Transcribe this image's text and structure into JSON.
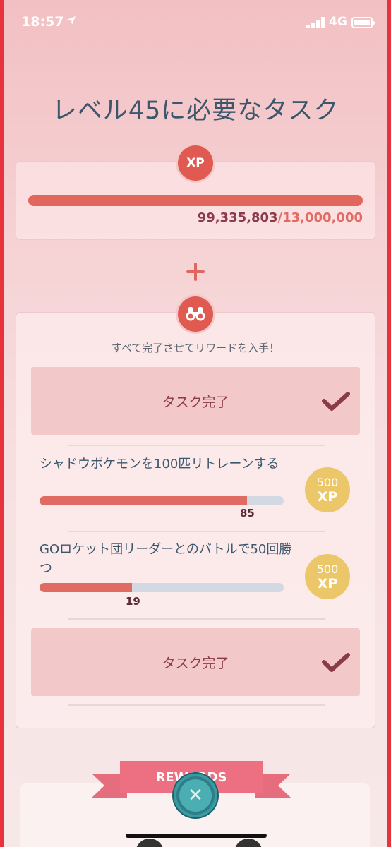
{
  "status_bar": {
    "time": "18:57",
    "network": "4G"
  },
  "title": "レベル45に必要なタスク",
  "xp": {
    "badge": "XP",
    "current": "99,335,803",
    "separator": "/",
    "goal": "13,000,000",
    "progress": 1.0
  },
  "tasks_section": {
    "subtitle": "すべて完了させてリワードを入手！",
    "done_label": "タスク完了",
    "tasks": [
      {
        "text": "シャドウポケモンを100匹リトレーンする",
        "progress_value": "85",
        "progress": 0.85,
        "reward_amount": "500",
        "reward_unit": "XP"
      },
      {
        "text": "GOロケット団リーダーとのバトルで50回勝つ",
        "progress_value": "19",
        "progress": 0.38,
        "reward_amount": "500",
        "reward_unit": "XP"
      }
    ],
    "done_label_2": "タスク完了"
  },
  "rewards": {
    "label": "REWARDS"
  },
  "colors": {
    "accent": "#e05a52",
    "reward_gold": "#ecc76a",
    "text": "#3c566b"
  },
  "icons": {
    "xp_badge": "xp-icon",
    "field_research": "binoculars-icon",
    "check": "check-icon",
    "close": "close-icon"
  }
}
